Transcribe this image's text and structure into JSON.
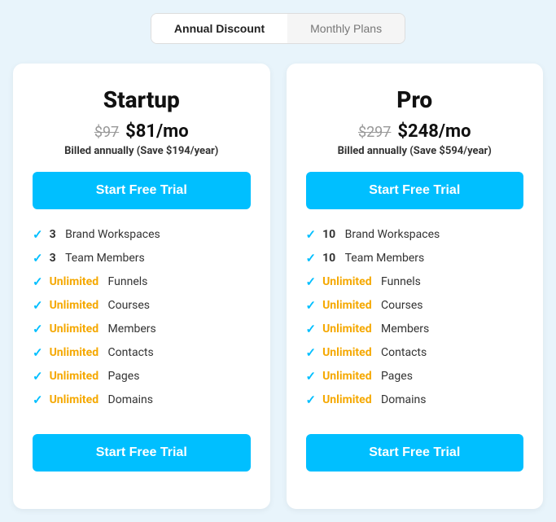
{
  "tabs": [
    {
      "id": "annual",
      "label": "Annual Discount",
      "active": true
    },
    {
      "id": "monthly",
      "label": "Monthly Plans",
      "active": false
    }
  ],
  "plans": [
    {
      "id": "startup",
      "name": "Startup",
      "price_old": "$97",
      "price_current": "$81/mo",
      "billed_note": "Billed annually ",
      "billed_save": "(Save $194/year)",
      "cta": "Start Free Trial",
      "features": [
        {
          "bold": "3",
          "bold_type": "dark",
          "text": " Brand Workspaces"
        },
        {
          "bold": "3",
          "bold_type": "dark",
          "text": " Team Members"
        },
        {
          "bold": "Unlimited",
          "bold_type": "accent",
          "text": " Funnels"
        },
        {
          "bold": "Unlimited",
          "bold_type": "accent",
          "text": " Courses"
        },
        {
          "bold": "Unlimited",
          "bold_type": "accent",
          "text": " Members"
        },
        {
          "bold": "Unlimited",
          "bold_type": "accent",
          "text": " Contacts"
        },
        {
          "bold": "Unlimited",
          "bold_type": "accent",
          "text": " Pages"
        },
        {
          "bold": "Unlimited",
          "bold_type": "accent",
          "text": " Domains"
        }
      ]
    },
    {
      "id": "pro",
      "name": "Pro",
      "price_old": "$297",
      "price_current": "$248/mo",
      "billed_note": "Billed annually ",
      "billed_save": "(Save $594/year)",
      "cta": "Start Free Trial",
      "features": [
        {
          "bold": "10",
          "bold_type": "dark",
          "text": " Brand Workspaces"
        },
        {
          "bold": "10",
          "bold_type": "dark",
          "text": " Team Members"
        },
        {
          "bold": "Unlimited",
          "bold_type": "accent",
          "text": " Funnels"
        },
        {
          "bold": "Unlimited",
          "bold_type": "accent",
          "text": " Courses"
        },
        {
          "bold": "Unlimited",
          "bold_type": "accent",
          "text": " Members"
        },
        {
          "bold": "Unlimited",
          "bold_type": "accent",
          "text": " Contacts"
        },
        {
          "bold": "Unlimited",
          "bold_type": "accent",
          "text": " Pages"
        },
        {
          "bold": "Unlimited",
          "bold_type": "accent",
          "text": " Domains"
        }
      ]
    }
  ]
}
